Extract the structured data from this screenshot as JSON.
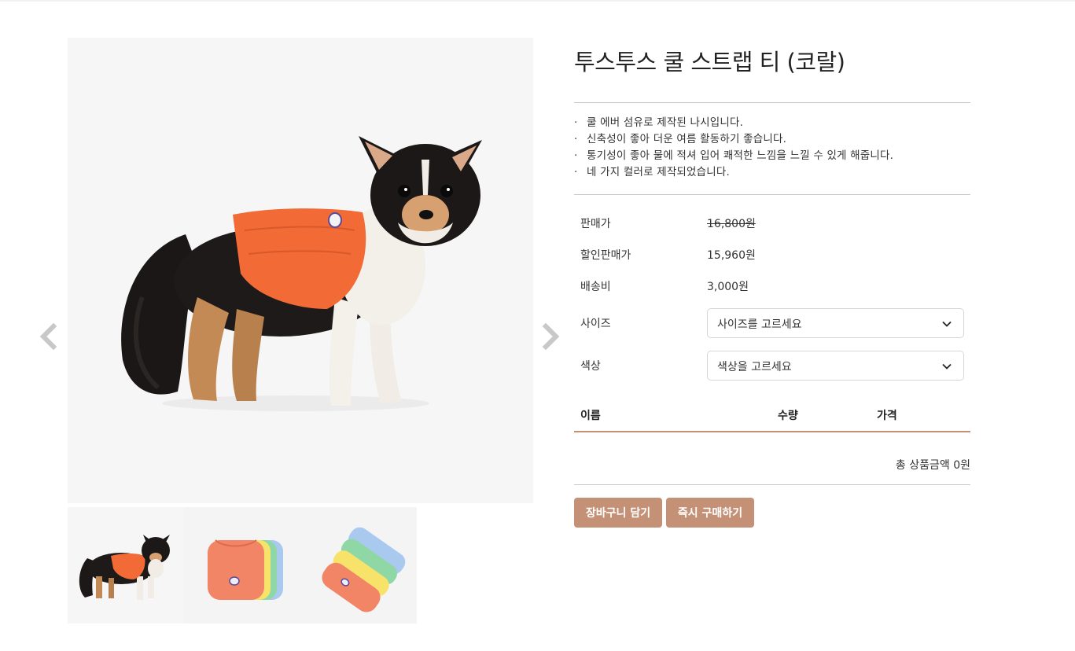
{
  "product": {
    "title": "투스투스 쿨 스트랩 티 (코랄)",
    "description": [
      "쿨 에버 섬유로 제작된 나시입니다.",
      "신축성이 좋아 더운 여름 활동하기 좋습니다.",
      "통기성이 좋아 물에 적셔 입어 쾌적한 느낌을 느낄 수 있게 해줍니다.",
      "네 가지 컬러로 제작되었습니다."
    ]
  },
  "pricing": {
    "list_price_label": "판매가",
    "list_price": "16,800원",
    "sale_price_label": "할인판매가",
    "sale_price": "15,960원",
    "shipping_label": "배송비",
    "shipping": "3,000원"
  },
  "options": {
    "size_label": "사이즈",
    "size_placeholder": "사이즈를 고르세요",
    "color_label": "색상",
    "color_placeholder": "색상을 고르세요"
  },
  "cart_table": {
    "headers": [
      "이름",
      "수량",
      "가격"
    ],
    "total_text": "총 상품금액 0원"
  },
  "actions": {
    "add_to_cart": "장바구니 담기",
    "buy_now": "즉시 구매하기"
  },
  "colors": {
    "accent": "#c49176",
    "shirt_coral": "#f26a35"
  },
  "icons": {
    "prev": "chevron-left-icon",
    "next": "chevron-right-icon",
    "dropdown": "chevron-down-icon"
  }
}
